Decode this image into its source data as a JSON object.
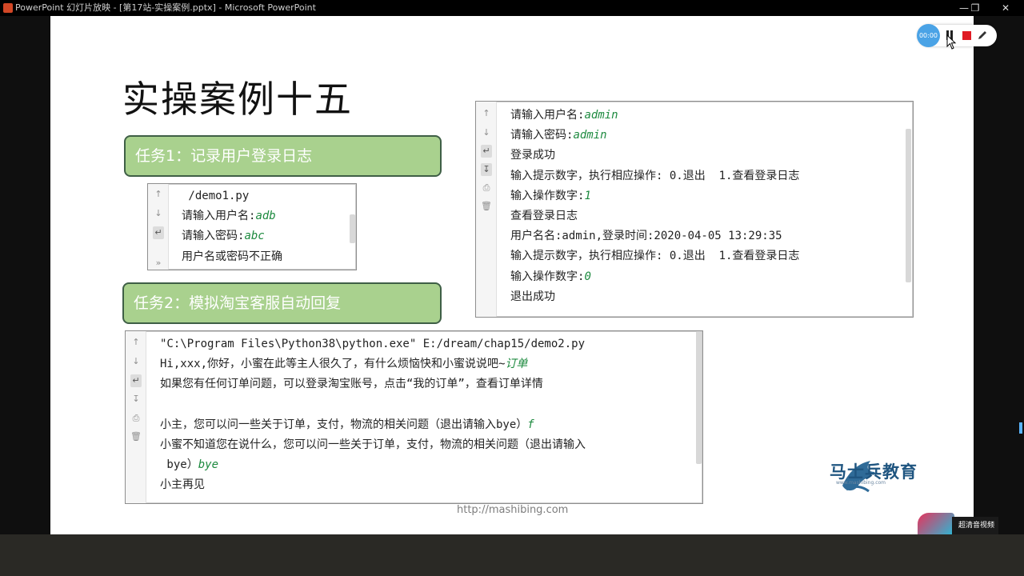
{
  "window": {
    "title": "PowerPoint 幻灯片放映 - [第17站-实操案例.pptx] - Microsoft PowerPoint"
  },
  "slide": {
    "title": "实操案例十五",
    "task1_label": "任务1：记录用户登录日志",
    "task2_label": "任务2：模拟淘宝客服自动回复",
    "footer_url": "http://mashibing.com"
  },
  "console_login": {
    "lines": [
      {
        "text": "请输入用户名:",
        "input": "admin"
      },
      {
        "text": "请输入密码:",
        "input": "admin"
      },
      {
        "text": "登录成功",
        "input": ""
      },
      {
        "text": "输入提示数字，执行相应操作: 0.退出  1.查看登录日志",
        "input": ""
      },
      {
        "text": "输入操作数字:",
        "input": "1"
      },
      {
        "text": "查看登录日志",
        "input": ""
      },
      {
        "text": "用户名名:admin,登录时间:2020-04-05 13:29:35",
        "input": ""
      },
      {
        "text": "输入提示数字，执行相应操作: 0.退出  1.查看登录日志",
        "input": ""
      },
      {
        "text": "输入操作数字:",
        "input": "0"
      },
      {
        "text": "退出成功",
        "input": ""
      }
    ]
  },
  "console_demo1": {
    "lines": [
      {
        "text": " /demo1.py",
        "input": ""
      },
      {
        "text": "请输入用户名:",
        "input": "adb"
      },
      {
        "text": "请输入密码:",
        "input": "abc"
      },
      {
        "text": "用户名或密码不正确",
        "input": ""
      }
    ]
  },
  "console_demo2": {
    "lines": [
      {
        "text": "\"C:\\Program Files\\Python38\\python.exe\" E:/dream/chap15/demo2.py",
        "input": ""
      },
      {
        "text": "Hi,xxx,你好，小蜜在此等主人很久了，有什么烦恼快和小蜜说说吧~",
        "input": "订单"
      },
      {
        "text": "如果您有任何订单问题，可以登录淘宝账号，点击“我的订单”，查看订单详情",
        "input": ""
      },
      {
        "text": "",
        "input": ""
      },
      {
        "text": "小主，您可以问一些关于订单，支付，物流的相关问题（退出请输入bye）",
        "input": "f"
      },
      {
        "text": "小蜜不知道您在说什么，您可以问一些关于订单，支付，物流的相关问题（退出请输入",
        "input": ""
      },
      {
        "text": " bye）",
        "input": "bye"
      },
      {
        "text": "小主再见",
        "input": ""
      }
    ]
  },
  "logo": {
    "name": "马士兵教育",
    "url": "www.mashibing.com"
  },
  "toolbar": {
    "timer": "00:00"
  },
  "badge": {
    "label": "超清音视频"
  },
  "icons": {
    "gutter": [
      "arrow-up-icon",
      "arrow-down-icon",
      "soft-wrap-icon",
      "scroll-to-end-icon",
      "print-icon",
      "trash-icon"
    ],
    "overlay": [
      "pause-icon",
      "stop-icon",
      "pen-icon"
    ]
  },
  "colors": {
    "task_fill": "#a9d18e",
    "task_border": "#3f5f46",
    "input_text": "#1d8a3f",
    "logo_blue": "#1f5580",
    "stop_red": "#e01b24"
  }
}
